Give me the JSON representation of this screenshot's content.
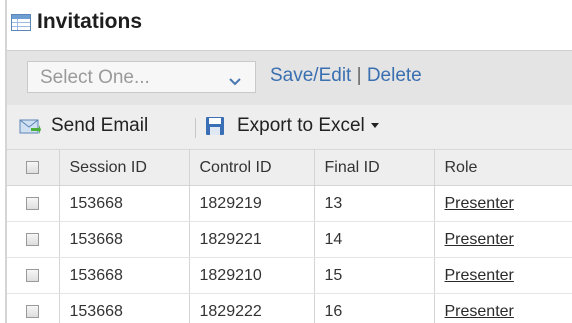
{
  "title": "Invitations",
  "filter": {
    "select_placeholder": "Select One...",
    "save_edit_label": "Save/Edit",
    "separator": "|",
    "delete_label": "Delete"
  },
  "toolbar": {
    "send_email_label": "Send Email",
    "export_label": "Export to Excel"
  },
  "table": {
    "columns": [
      "Session ID",
      "Control ID",
      "Final ID",
      "Role"
    ],
    "rows": [
      {
        "session_id": "153668",
        "control_id": "1829219",
        "final_id": "13",
        "role": "Presenter"
      },
      {
        "session_id": "153668",
        "control_id": "1829221",
        "final_id": "14",
        "role": "Presenter"
      },
      {
        "session_id": "153668",
        "control_id": "1829210",
        "final_id": "15",
        "role": "Presenter"
      },
      {
        "session_id": "153668",
        "control_id": "1829222",
        "final_id": "16",
        "role": "Presenter"
      }
    ]
  },
  "icons": {
    "title": "table-icon",
    "send_email": "send-email-icon",
    "export": "save-disk-icon",
    "dropdown": "chevron-down-icon"
  },
  "colors": {
    "link": "#3a6fb0",
    "filter_bar_bg": "#e4e4e4",
    "toolbar_bg": "#eeeeee"
  }
}
